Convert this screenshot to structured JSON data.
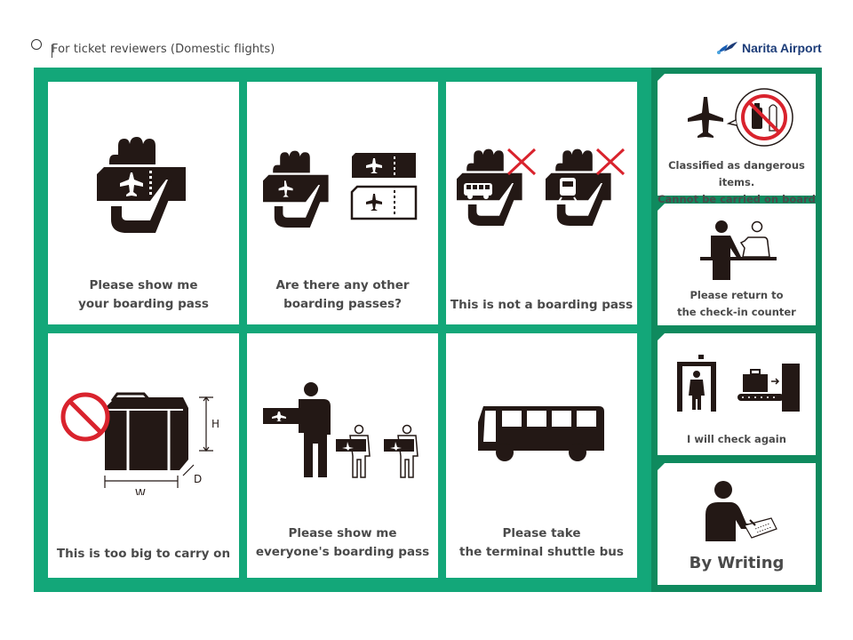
{
  "header": {
    "title": "For ticket reviewers (Domestic flights)",
    "logo_text": "Narita Airport",
    "brand_color": "#1c3c78"
  },
  "colors": {
    "frame_green": "#13a779",
    "right_column_green": "#0f8a5e",
    "icon_black": "#231815",
    "prohibit_red": "#d9232d",
    "text_gray": "#4a4a4a"
  },
  "main_panels": [
    {
      "icon": "hand-holding-boarding-pass-icon",
      "lines": [
        "Please show me",
        "your boarding pass"
      ]
    },
    {
      "icon": "multiple-boarding-passes-icon",
      "lines": [
        "Are there any other",
        "boarding passes?"
      ]
    },
    {
      "icon": "bus-train-ticket-crossed-icon",
      "lines": [
        "This is not a boarding pass"
      ]
    },
    {
      "icon": "oversized-suitcase-prohibited-icon",
      "lines": [
        "This is too big to carry on"
      ],
      "dimension_labels": [
        "H",
        "W",
        "D"
      ]
    },
    {
      "icon": "group-boarding-passes-icon",
      "lines": [
        "Please show me",
        "everyone's boarding pass"
      ]
    },
    {
      "icon": "shuttle-bus-icon",
      "lines": [
        "Please take",
        "the terminal shuttle bus"
      ]
    }
  ],
  "side_panels": [
    {
      "icon": "dangerous-items-prohibited-icon",
      "lines": [
        "Classified as dangerous items.",
        "Cannot be carried on board"
      ]
    },
    {
      "icon": "check-in-counter-icon",
      "lines": [
        "Please return to",
        "the check-in counter"
      ]
    },
    {
      "icon": "security-check-icon",
      "lines": [
        "I will check again"
      ]
    },
    {
      "icon": "person-writing-icon",
      "lines": [
        "By Writing"
      ]
    }
  ]
}
